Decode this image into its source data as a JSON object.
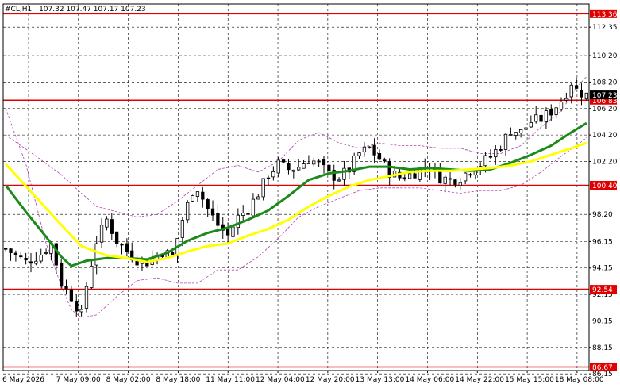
{
  "header": {
    "symbol": "#CL,H1",
    "ohlc": "107.32 107.47 107.17 107.23"
  },
  "chart_data": {
    "type": "candlestick",
    "ylim": [
      86.4,
      114.1
    ],
    "grid": true,
    "y_ticks": [
      "112.35",
      "110.20",
      "108.20",
      "106.20",
      "104.20",
      "102.20",
      "98.20",
      "96.15",
      "94.15",
      "92.15",
      "90.15",
      "88.15",
      "86.15"
    ],
    "x_ticks": [
      "6 May 2026",
      "7 May 09:00",
      "8 May 02:00",
      "8 May 18:00",
      "11 May 11:00",
      "12 May 04:00",
      "12 May 20:00",
      "13 May 13:00",
      "14 May 06:00",
      "14 May 22:00",
      "15 May 15:00",
      "18 May 08:00"
    ],
    "levels": [
      {
        "label": "113.36",
        "value": 113.36,
        "color": "#e00000"
      },
      {
        "label": "106.83",
        "value": 106.83,
        "color": "#e00000"
      },
      {
        "label": "100.40",
        "value": 100.4,
        "color": "#e00000"
      },
      {
        "label": "92.54",
        "value": 92.54,
        "color": "#e00000"
      },
      {
        "label": "86.67",
        "value": 86.67,
        "color": "#e00000"
      }
    ],
    "current_price": {
      "label": "107.23",
      "value": 107.23
    },
    "close_path": [
      [
        0,
        95.6
      ],
      [
        4,
        94.6
      ],
      [
        7,
        95.2
      ],
      [
        9,
        96.0
      ],
      [
        11,
        93.0
      ],
      [
        13,
        92.0
      ],
      [
        15,
        90.6
      ],
      [
        16,
        92.8
      ],
      [
        18,
        96.2
      ],
      [
        20,
        97.8
      ],
      [
        22,
        96.2
      ],
      [
        24,
        95.4
      ],
      [
        26,
        94.8
      ],
      [
        28,
        94.6
      ],
      [
        31,
        95.4
      ],
      [
        33,
        95.0
      ],
      [
        35,
        97.8
      ],
      [
        37,
        100.0
      ],
      [
        38,
        100.2
      ],
      [
        40,
        98.6
      ],
      [
        42,
        97.4
      ],
      [
        44,
        96.6
      ],
      [
        46,
        98.0
      ],
      [
        48,
        98.6
      ],
      [
        50,
        99.8
      ],
      [
        52,
        101.2
      ],
      [
        54,
        102.0
      ],
      [
        56,
        101.6
      ],
      [
        58,
        101.8
      ],
      [
        60,
        102.4
      ],
      [
        62,
        102.0
      ],
      [
        64,
        101.2
      ],
      [
        66,
        101.0
      ],
      [
        68,
        101.6
      ],
      [
        70,
        102.8
      ],
      [
        72,
        103.2
      ],
      [
        74,
        102.4
      ],
      [
        76,
        101.4
      ],
      [
        78,
        101.0
      ],
      [
        80,
        101.2
      ],
      [
        82,
        101.6
      ],
      [
        84,
        101.8
      ],
      [
        86,
        101.0
      ],
      [
        88,
        100.8
      ],
      [
        90,
        101.0
      ],
      [
        92,
        101.6
      ],
      [
        94,
        102.0
      ],
      [
        96,
        102.6
      ],
      [
        98,
        103.4
      ],
      [
        100,
        104.6
      ],
      [
        102,
        104.4
      ],
      [
        104,
        105.2
      ],
      [
        106,
        105.4
      ],
      [
        108,
        106.0
      ],
      [
        110,
        106.8
      ],
      [
        111,
        107.4
      ],
      [
        112,
        108.2
      ],
      [
        113,
        107.6
      ],
      [
        114,
        107.4
      ],
      [
        115,
        107.23
      ]
    ],
    "candle_count": 116,
    "series": [
      {
        "name": "",
        "color": "#1a8a1a",
        "points": [
          [
            0,
            100.4
          ],
          [
            4,
            98.4
          ],
          [
            8,
            96.5
          ],
          [
            11,
            95.0
          ],
          [
            13,
            94.3
          ],
          [
            16,
            94.7
          ],
          [
            20,
            94.9
          ],
          [
            24,
            94.9
          ],
          [
            28,
            94.8
          ],
          [
            32,
            95.3
          ],
          [
            36,
            96.2
          ],
          [
            40,
            96.8
          ],
          [
            44,
            97.2
          ],
          [
            48,
            97.8
          ],
          [
            52,
            98.5
          ],
          [
            56,
            99.6
          ],
          [
            60,
            100.8
          ],
          [
            64,
            101.3
          ],
          [
            68,
            101.5
          ],
          [
            72,
            101.8
          ],
          [
            76,
            101.8
          ],
          [
            80,
            101.6
          ],
          [
            84,
            101.7
          ],
          [
            88,
            101.6
          ],
          [
            92,
            101.5
          ],
          [
            96,
            101.6
          ],
          [
            100,
            102.1
          ],
          [
            104,
            102.7
          ],
          [
            108,
            103.4
          ],
          [
            112,
            104.4
          ],
          [
            115,
            105.1
          ]
        ]
      },
      {
        "name": "",
        "color": "#ffff00",
        "points": [
          [
            0,
            102.0
          ],
          [
            6,
            99.5
          ],
          [
            11,
            97.4
          ],
          [
            15,
            95.8
          ],
          [
            20,
            95.1
          ],
          [
            24,
            94.9
          ],
          [
            28,
            94.6
          ],
          [
            32,
            94.9
          ],
          [
            36,
            95.4
          ],
          [
            40,
            95.8
          ],
          [
            44,
            96.0
          ],
          [
            48,
            96.6
          ],
          [
            52,
            97.1
          ],
          [
            56,
            97.8
          ],
          [
            60,
            98.8
          ],
          [
            64,
            99.6
          ],
          [
            68,
            100.3
          ],
          [
            72,
            100.8
          ],
          [
            76,
            101.1
          ],
          [
            80,
            101.4
          ],
          [
            84,
            101.5
          ],
          [
            88,
            101.5
          ],
          [
            92,
            101.6
          ],
          [
            96,
            101.7
          ],
          [
            100,
            101.9
          ],
          [
            104,
            102.2
          ],
          [
            108,
            102.7
          ],
          [
            112,
            103.2
          ],
          [
            115,
            103.6
          ]
        ]
      }
    ],
    "bands": {
      "color": "#b040b0",
      "upper": [
        [
          0,
          104.2
        ],
        [
          6,
          102.6
        ],
        [
          11,
          101.2
        ],
        [
          15,
          99.8
        ],
        [
          18,
          98.8
        ],
        [
          22,
          98.4
        ],
        [
          26,
          98.0
        ],
        [
          30,
          98.2
        ],
        [
          34,
          99.2
        ],
        [
          38,
          100.4
        ],
        [
          42,
          101.6
        ],
        [
          46,
          101.9
        ],
        [
          50,
          101.4
        ],
        [
          54,
          102.2
        ],
        [
          58,
          103.8
        ],
        [
          62,
          104.4
        ],
        [
          66,
          103.6
        ],
        [
          70,
          103.2
        ],
        [
          74,
          103.6
        ],
        [
          78,
          103.4
        ],
        [
          82,
          103.4
        ],
        [
          86,
          103.2
        ],
        [
          90,
          103.2
        ],
        [
          94,
          102.8
        ],
        [
          98,
          102.8
        ],
        [
          102,
          103.4
        ],
        [
          106,
          104.8
        ],
        [
          110,
          106.0
        ],
        [
          113,
          107.8
        ],
        [
          115,
          108.6
        ]
      ],
      "lower": [
        [
          0,
          106.2
        ],
        [
          4,
          102.0
        ],
        [
          8,
          96.0
        ],
        [
          11,
          92.8
        ],
        [
          13,
          91.0
        ],
        [
          15,
          90.4
        ],
        [
          18,
          90.6
        ],
        [
          22,
          92.0
        ],
        [
          26,
          93.2
        ],
        [
          30,
          93.4
        ],
        [
          34,
          93.0
        ],
        [
          38,
          93.0
        ],
        [
          42,
          94.0
        ],
        [
          46,
          94.0
        ],
        [
          50,
          95.0
        ],
        [
          54,
          96.4
        ],
        [
          58,
          98.0
        ],
        [
          62,
          98.8
        ],
        [
          66,
          99.4
        ],
        [
          70,
          100.0
        ],
        [
          74,
          100.2
        ],
        [
          78,
          100.2
        ],
        [
          82,
          100.2
        ],
        [
          86,
          100.0
        ],
        [
          90,
          99.8
        ],
        [
          94,
          100.0
        ],
        [
          98,
          100.0
        ],
        [
          102,
          100.4
        ],
        [
          106,
          101.4
        ],
        [
          110,
          102.6
        ],
        [
          113,
          103.4
        ],
        [
          115,
          104.0
        ]
      ]
    }
  }
}
